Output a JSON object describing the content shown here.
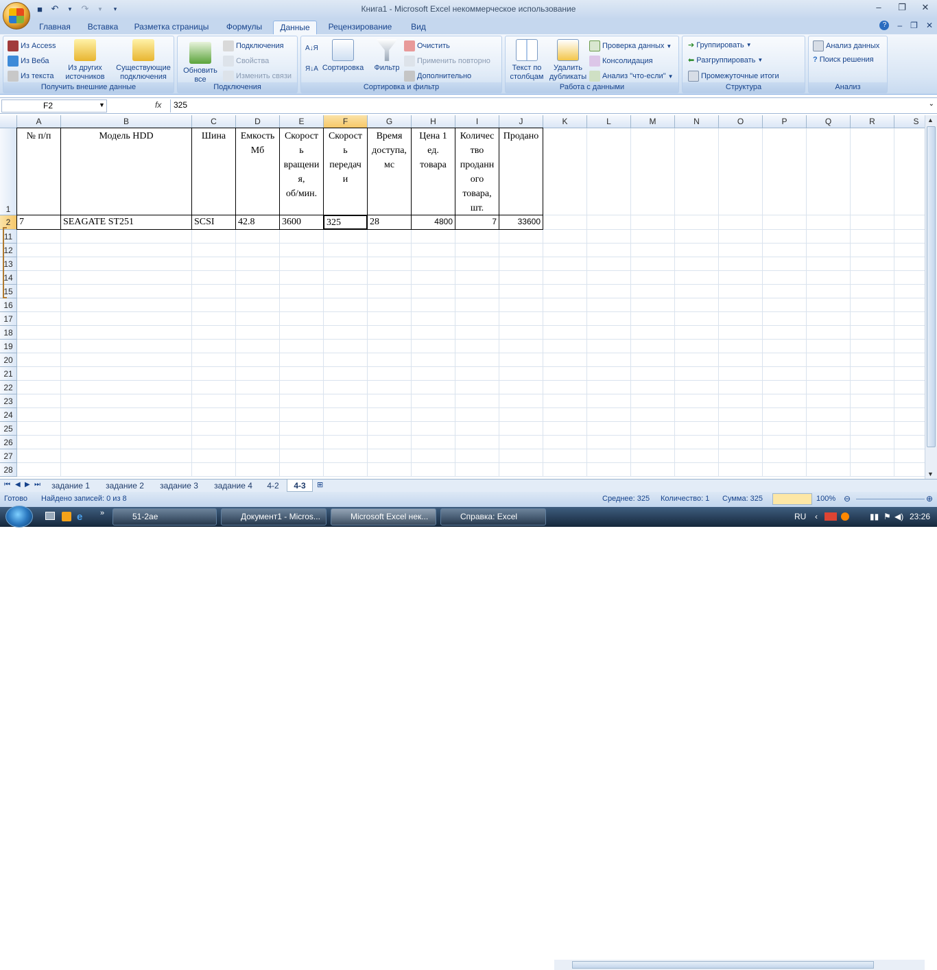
{
  "window": {
    "title": "Книга1  -  Microsoft Excel некоммерческое использование",
    "controls": [
      "–",
      "❐",
      "✕"
    ]
  },
  "tabs": [
    "Главная",
    "Вставка",
    "Разметка страницы",
    "Формулы",
    "Данные",
    "Рецензирование",
    "Вид"
  ],
  "ribbon": {
    "get_external": {
      "label": "Получить внешние данные",
      "access": "Из Access",
      "web": "Из Веба",
      "text": "Из текста",
      "other": "Из других источников",
      "existing": "Существующие подключения"
    },
    "connections": {
      "label": "Подключения",
      "refresh": "Обновить все",
      "connections": "Подключения",
      "properties": "Свойства",
      "edit_links": "Изменить связи"
    },
    "sort_filter": {
      "label": "Сортировка и фильтр",
      "sort": "Сортировка",
      "filter": "Фильтр",
      "clear": "Очистить",
      "reapply": "Применить повторно",
      "advanced": "Дополнительно"
    },
    "data_tools": {
      "label": "Работа с данными",
      "text_to_cols": "Текст по столбцам",
      "remove_dup": "Удалить дубликаты",
      "validation": "Проверка данных",
      "consolidate": "Консолидация",
      "whatif": "Анализ \"что-если\""
    },
    "outline": {
      "label": "Структура",
      "group": "Группировать",
      "ungroup": "Разгруппировать",
      "subtotal": "Промежуточные итоги"
    },
    "analysis": {
      "label": "Анализ",
      "data_analysis": "Анализ данных",
      "solver": "Поиск решения"
    }
  },
  "formula_bar": {
    "name_box": "F2",
    "fx": "fx",
    "value": "325"
  },
  "columns": [
    "A",
    "B",
    "C",
    "D",
    "E",
    "F",
    "G",
    "H",
    "I",
    "J",
    "K",
    "L",
    "M",
    "N",
    "O",
    "P",
    "Q",
    "R",
    "S"
  ],
  "rows": [
    "1",
    "2",
    "11",
    "12",
    "13",
    "14",
    "15",
    "16",
    "17",
    "18",
    "19",
    "20",
    "21",
    "22",
    "23",
    "24",
    "25",
    "26",
    "27",
    "28"
  ],
  "table": {
    "headers": [
      "№ п/п",
      "Модель HDD",
      "Шина",
      "Емкость Мб",
      "Скорост\nь\nвращени\nя,\nоб/мин.",
      "Скорост\nь\nпередач\nи",
      "Время\nдоступа,\nмс",
      "Цена 1\nед.\nтовара",
      "Количес\nтво\nпроданн\nого\nтовара,\nшт.",
      "Продано"
    ],
    "row": [
      "7",
      "SEAGATE ST251",
      "SCSI",
      "42.8",
      "3600",
      "325",
      "28",
      "4800",
      "7",
      "33600"
    ]
  },
  "sheets": [
    "задание 1",
    "задание 2",
    "задание 3",
    "задание 4",
    "4-2",
    "4-3"
  ],
  "status": {
    "ready": "Готово",
    "found": "Найдено записей: 0 из 8",
    "avg": "Среднее: 325",
    "count": "Количество: 1",
    "sum": "Сумма: 325",
    "zoom": "100%"
  },
  "taskbar": {
    "items": [
      "51-2ае",
      "Документ1 - Micros...",
      "Microsoft Excel нек...",
      "Справка: Excel"
    ],
    "lang": "RU",
    "time": "23:26"
  }
}
